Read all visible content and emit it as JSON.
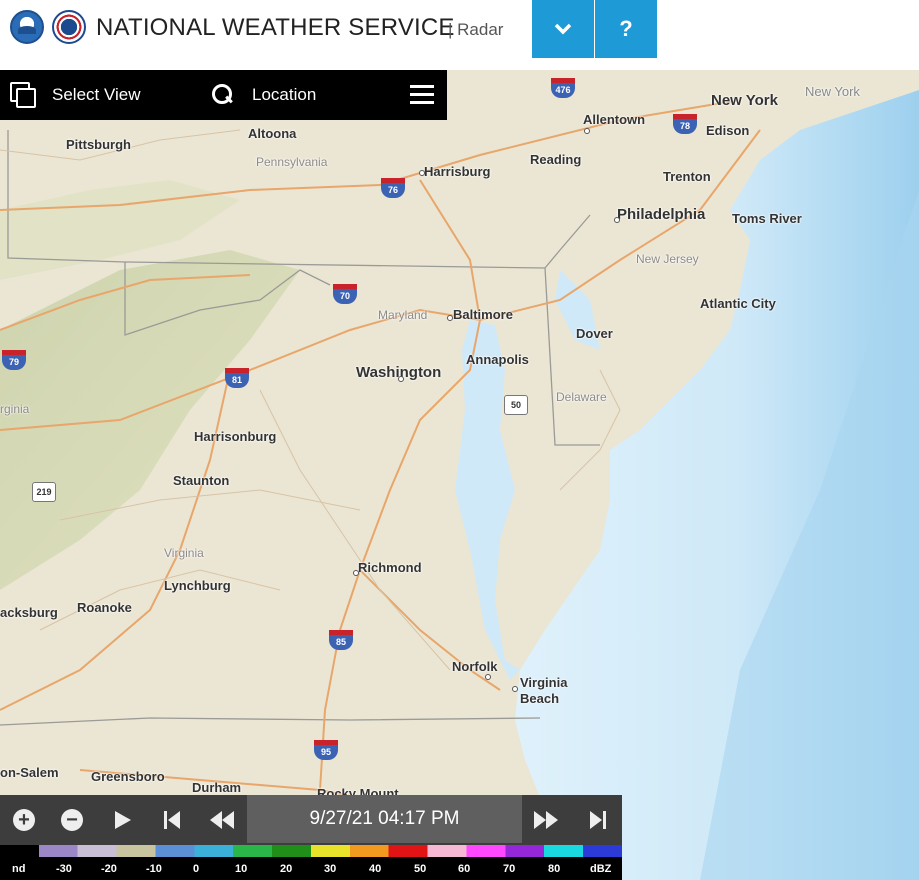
{
  "header": {
    "title": "NATIONAL WEATHER SERVICE",
    "subtitle": "| Radar",
    "help_label": "?",
    "menu_icon": "chevron-down-icon"
  },
  "toolbar": {
    "select_view_label": "Select View",
    "location_label": "Location"
  },
  "map": {
    "places": [
      "New York",
      "New York",
      "Allentown",
      "Edison",
      "Pittsburgh",
      "Altoona",
      "Pennsylvania",
      "Harrisburg",
      "Reading",
      "Trenton",
      "Philadelphia",
      "Toms River",
      "New Jersey",
      "Atlantic City",
      "Maryland",
      "Baltimore",
      "Dover",
      "Annapolis",
      "Washington",
      "Delaware",
      "rginia",
      "Harrisonburg",
      "Staunton",
      "Virginia",
      "Lynchburg",
      "Richmond",
      "acksburg",
      "Roanoke",
      "Norfolk",
      "Virginia",
      "Beach",
      "on-Salem",
      "Greensboro",
      "Durham",
      "Rocky Mount"
    ],
    "shields": [
      "476",
      "78",
      "76",
      "70",
      "79",
      "81",
      "50",
      "219",
      "85",
      "95"
    ]
  },
  "playback": {
    "timestamp": "9/27/21 04:17 PM"
  },
  "legend": {
    "ticks": [
      "nd",
      "-30",
      "-20",
      "-10",
      "0",
      "10",
      "20",
      "30",
      "40",
      "50",
      "60",
      "70",
      "80",
      "dBZ"
    ],
    "colors": [
      "#000000",
      "#9b86c8",
      "#c8bfd6",
      "#c8c4a0",
      "#5b8fd6",
      "#3bb0d8",
      "#2ab648",
      "#1f8f1a",
      "#e8e22a",
      "#f29a1f",
      "#e01414",
      "#f7b8d6",
      "#ff48ff",
      "#9428d8",
      "#1ad8e0",
      "#2c3ad8"
    ]
  }
}
